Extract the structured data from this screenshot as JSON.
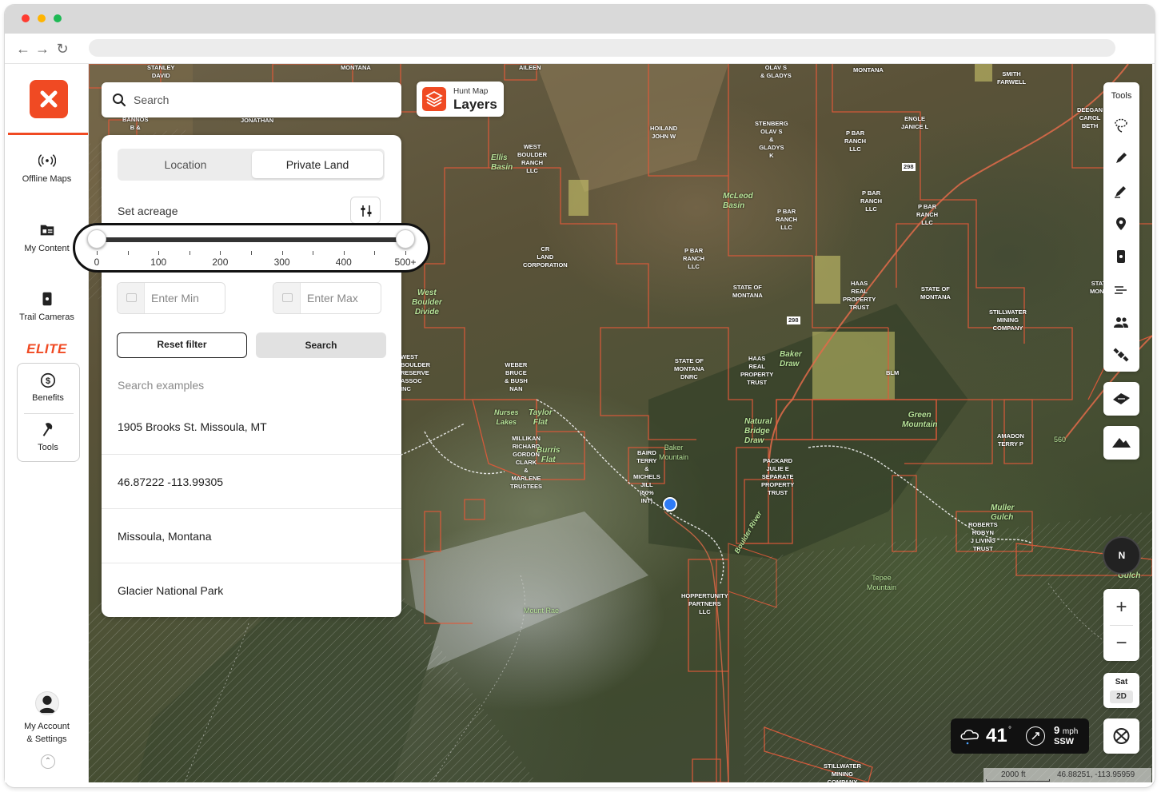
{
  "app": {
    "brand_color": "#f04a23",
    "offline_maps": "Offline Maps",
    "my_content": "My Content",
    "trail_cameras": "Trail Cameras",
    "elite": "ELITE",
    "benefits": "Benefits",
    "tools": "Tools",
    "my_account": "My Account",
    "settings": "& Settings"
  },
  "search": {
    "placeholder": "Search"
  },
  "layers": {
    "top": "Hunt Map",
    "main": "Layers"
  },
  "panel": {
    "tabs": [
      "Location",
      "Private Land"
    ],
    "active_tab": "Private Land",
    "set_acreage": "Set acreage",
    "slider": {
      "min": 0,
      "max": 500,
      "selected_min": 0,
      "selected_max": 500,
      "labels": [
        "0",
        "100",
        "200",
        "300",
        "400",
        "500+"
      ]
    },
    "min_placeholder": "Enter Min",
    "max_placeholder": "Enter Max",
    "reset_label": "Reset filter",
    "search_label": "Search",
    "examples_title": "Search examples",
    "examples": [
      "1905 Brooks St. Missoula, MT",
      "46.87222 -113.99305",
      "Missoula, Montana",
      "Glacier National Park"
    ]
  },
  "tools": {
    "title": "Tools",
    "icons": [
      "lasso-icon",
      "pen-icon",
      "marker-pen-icon",
      "waypoint-pin-icon",
      "trail-camera-icon",
      "wind-icon",
      "people-icon",
      "satellite-icon"
    ]
  },
  "weather": {
    "temp": "41",
    "deg": "°",
    "speed": "9",
    "speed_unit": "mph",
    "direction": "SSW"
  },
  "map_controls": {
    "compass": "N",
    "zoom_in": "+",
    "zoom_out": "−",
    "basemap": "Sat",
    "mode": "2D",
    "scale": "2000 ft",
    "coords": "46.88251, -113.95959"
  },
  "map_labels": [
    {
      "text": "STANLEY\nDAVID"
    },
    {
      "text": "MONTANA"
    },
    {
      "text": "AILEEN"
    },
    {
      "text": "OLAV S\n& GLADYS"
    },
    {
      "text": "MONTANA"
    },
    {
      "text": "SMITH\nFARWELL"
    },
    {
      "text": "DEEGAN\nCAROL\nBETH"
    },
    {
      "text": "BANNOS\nB &"
    },
    {
      "text": "JONATHAN"
    },
    {
      "text": "HOILAND\nJOHN W"
    },
    {
      "text": "STENBERG\nOLAV S\n&\nGLADYS\nK"
    },
    {
      "text": "P BAR\nRANCH\nLLC"
    },
    {
      "text": "ENGLE\nJANICE L"
    },
    {
      "text": "WEST\nBOULDER\nRANCH\nLLC"
    },
    {
      "text": "P BAR\nRANCH\nLLC"
    },
    {
      "text": "P BAR\nRANCH\nLLC"
    },
    {
      "text": "P BAR\nRANCH\nLLC"
    },
    {
      "text": "CR\nLAND\nCORPORATION"
    },
    {
      "text": "P BAR\nRANCH\nLLC"
    },
    {
      "text": "STATE OF\nMONTANA"
    },
    {
      "text": "HAAS\nREAL\nPROPERTY\nTRUST"
    },
    {
      "text": "STATE OF\nMONTANA"
    },
    {
      "text": "STATE\nMONTA"
    },
    {
      "text": "STILLWATER\nMINING\nCOMPANY"
    },
    {
      "text": "WEST\nBOULDER\nRESERVE\nASSOC\nINC"
    },
    {
      "text": "WEBER\nBRUCE\n& BUSH\nNAN"
    },
    {
      "text": "STATE OF\nMONTANA\nDNRC"
    },
    {
      "text": "HAAS\nREAL\nPROPERTY\nTRUST"
    },
    {
      "text": "BLM"
    },
    {
      "text": "AMADON\nTERRY P"
    },
    {
      "text": "MILLIKAN\nRICHARD\nGORDON\nCLARK\n&\nMARLENE\nTRUSTEES"
    },
    {
      "text": "BAIRD\nTERRY\n&\nMICHELS\nJILL\n(50%\nINT)"
    },
    {
      "text": "PACKARD\nJULIE E\nSEPARATE\nPROPERTY\nTRUST"
    },
    {
      "text": "ROBERTS\nROBYN\nJ LIVING\nTRUST"
    },
    {
      "text": "HOPPERTUNITY\nPARTNERS\nLLC"
    },
    {
      "text": "STILLWATER\nMINING\nCOMPANY"
    }
  ],
  "map_place_names": [
    {
      "text": "Ellis\nBasin"
    },
    {
      "text": "McLeod\nBasin"
    },
    {
      "text": "West\nBoulder\nDivide"
    },
    {
      "text": "Taylor\nFlat"
    },
    {
      "text": "Nurses\nLakes"
    },
    {
      "text": "Burris\nFlat"
    },
    {
      "text": "Baker\nMountain"
    },
    {
      "text": "Baker\nDraw"
    },
    {
      "text": "Natural\nBridge\nDraw"
    },
    {
      "text": "Green\nMountain"
    },
    {
      "text": "Tepee\nMountain"
    },
    {
      "text": "Mount Rae"
    },
    {
      "text": "Boulder River"
    },
    {
      "text": "Muller\nGulch"
    },
    {
      "text": "Gulch"
    },
    {
      "text": "560"
    },
    {
      "text": "298"
    },
    {
      "text": "298"
    }
  ]
}
